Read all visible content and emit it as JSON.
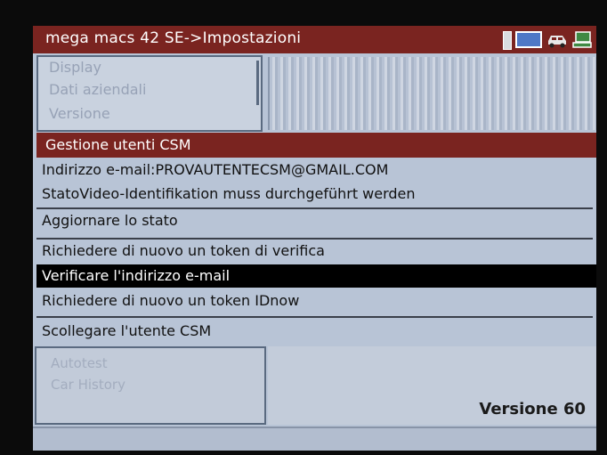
{
  "title_bar": {
    "title": "mega macs 42 SE->Impostazioni",
    "icons": [
      "battery-icon",
      "screen-icon",
      "car-icon",
      "network-icon"
    ]
  },
  "top_menu": {
    "items": [
      "Display",
      "Dati aziendali",
      "Versione"
    ]
  },
  "section": {
    "header": "Gestione utenti CSM"
  },
  "info": {
    "email_line": "Indirizzo e-mail:PROVAUTENTECSM@GMAIL.COM",
    "status_line": "StatoVideo-Identifikation muss durchgeführt werden"
  },
  "actions": [
    {
      "label": "Aggiornare lo stato",
      "selected": false
    },
    {
      "label": "Richiedere di nuovo un token di verifica",
      "selected": false
    },
    {
      "label": "Verificare l'indirizzo e-mail",
      "selected": true
    },
    {
      "label": "Richiedere di nuovo un token IDnow",
      "selected": false
    },
    {
      "label": "Scollegare l'utente CSM",
      "selected": false
    }
  ],
  "bottom_menu": {
    "items": [
      "Autotest",
      "Car History"
    ]
  },
  "footer": {
    "version": "Versione 60"
  },
  "colors": {
    "title_bar": "#7a2420",
    "selection": "#000000",
    "screen_bg": "#b8c4d6"
  }
}
